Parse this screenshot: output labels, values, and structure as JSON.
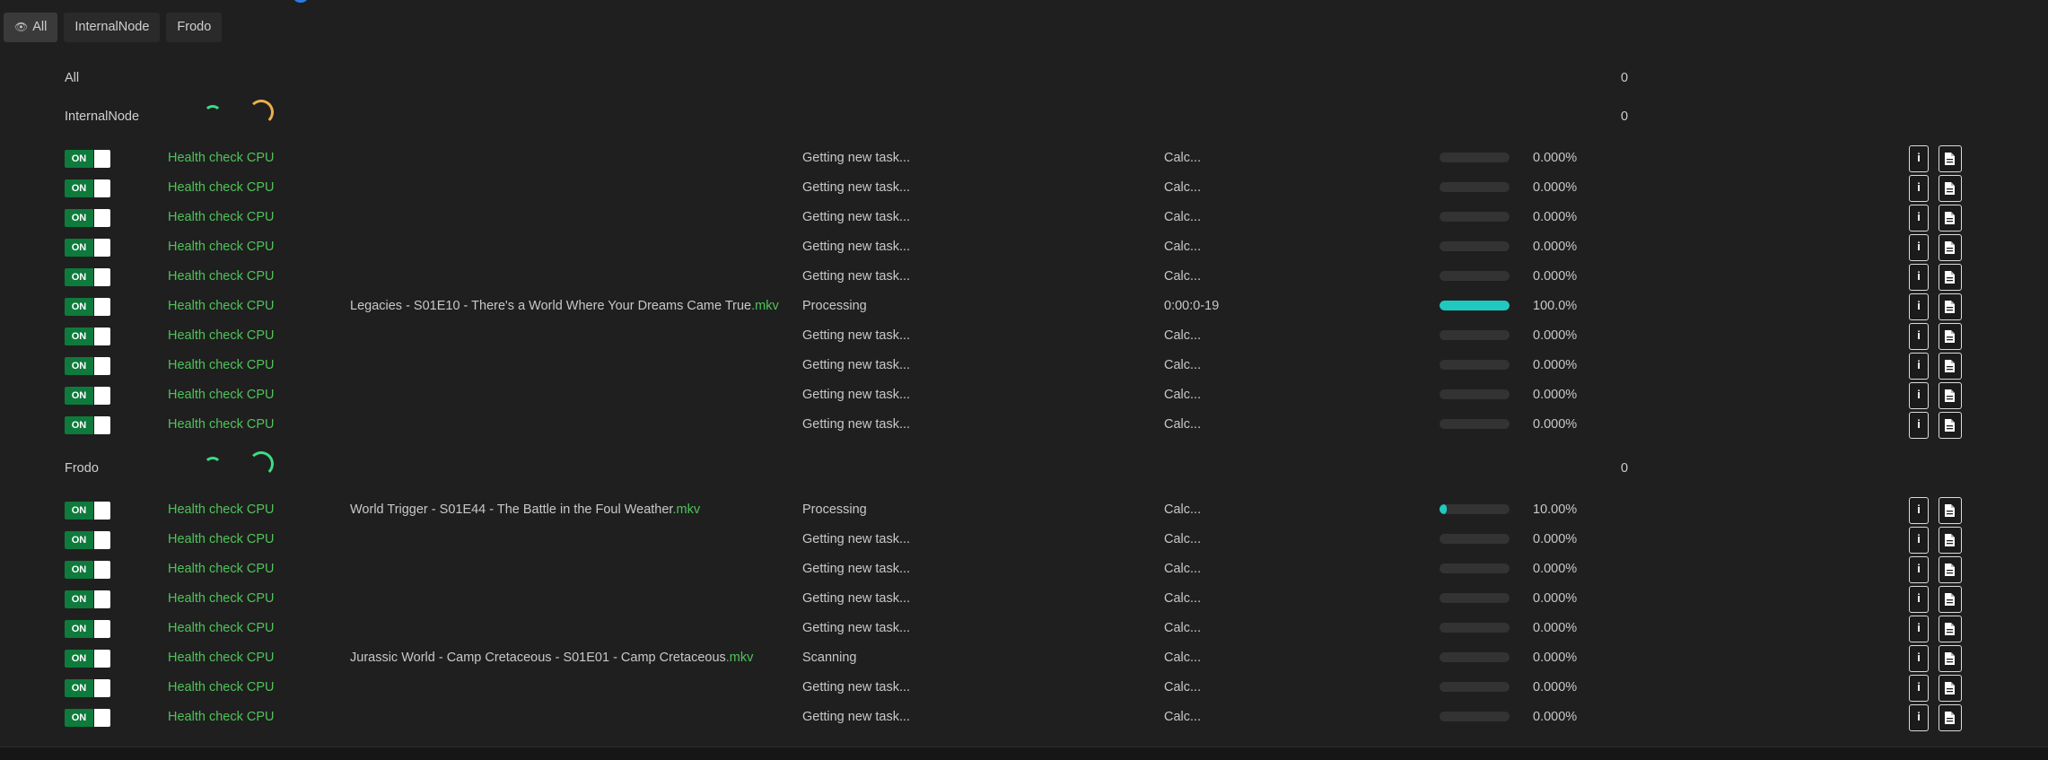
{
  "tabs": [
    {
      "label": "All",
      "active": true
    },
    {
      "label": "InternalNode",
      "active": false
    },
    {
      "label": "Frodo",
      "active": false
    }
  ],
  "groups": [
    {
      "name": "All",
      "count": "0",
      "workers": []
    },
    {
      "name": "InternalNode",
      "count": "0",
      "workers": [
        {
          "toggle": "ON",
          "plugin": "Health check CPU",
          "file": "",
          "ext": "",
          "status": "Getting new task...",
          "eta": "Calc...",
          "progress": 0,
          "pct": "0.000%"
        },
        {
          "toggle": "ON",
          "plugin": "Health check CPU",
          "file": "",
          "ext": "",
          "status": "Getting new task...",
          "eta": "Calc...",
          "progress": 0,
          "pct": "0.000%"
        },
        {
          "toggle": "ON",
          "plugin": "Health check CPU",
          "file": "",
          "ext": "",
          "status": "Getting new task...",
          "eta": "Calc...",
          "progress": 0,
          "pct": "0.000%"
        },
        {
          "toggle": "ON",
          "plugin": "Health check CPU",
          "file": "",
          "ext": "",
          "status": "Getting new task...",
          "eta": "Calc...",
          "progress": 0,
          "pct": "0.000%"
        },
        {
          "toggle": "ON",
          "plugin": "Health check CPU",
          "file": "",
          "ext": "",
          "status": "Getting new task...",
          "eta": "Calc...",
          "progress": 0,
          "pct": "0.000%"
        },
        {
          "toggle": "ON",
          "plugin": "Health check CPU",
          "file": "Legacies - S01E10 - There's a World Where Your Dreams Came True",
          "ext": ".mkv",
          "status": "Processing",
          "eta": "0:00:0-19",
          "progress": 100,
          "pct": "100.0%"
        },
        {
          "toggle": "ON",
          "plugin": "Health check CPU",
          "file": "",
          "ext": "",
          "status": "Getting new task...",
          "eta": "Calc...",
          "progress": 0,
          "pct": "0.000%"
        },
        {
          "toggle": "ON",
          "plugin": "Health check CPU",
          "file": "",
          "ext": "",
          "status": "Getting new task...",
          "eta": "Calc...",
          "progress": 0,
          "pct": "0.000%"
        },
        {
          "toggle": "ON",
          "plugin": "Health check CPU",
          "file": "",
          "ext": "",
          "status": "Getting new task...",
          "eta": "Calc...",
          "progress": 0,
          "pct": "0.000%"
        },
        {
          "toggle": "ON",
          "plugin": "Health check CPU",
          "file": "",
          "ext": "",
          "status": "Getting new task...",
          "eta": "Calc...",
          "progress": 0,
          "pct": "0.000%"
        }
      ]
    },
    {
      "name": "Frodo",
      "count": "0",
      "workers": [
        {
          "toggle": "ON",
          "plugin": "Health check CPU",
          "file": "World Trigger - S01E44 - The Battle in the Foul Weather",
          "ext": ".mkv",
          "status": "Processing",
          "eta": "Calc...",
          "progress": 10,
          "pct": "10.00%"
        },
        {
          "toggle": "ON",
          "plugin": "Health check CPU",
          "file": "",
          "ext": "",
          "status": "Getting new task...",
          "eta": "Calc...",
          "progress": 0,
          "pct": "0.000%"
        },
        {
          "toggle": "ON",
          "plugin": "Health check CPU",
          "file": "",
          "ext": "",
          "status": "Getting new task...",
          "eta": "Calc...",
          "progress": 0,
          "pct": "0.000%"
        },
        {
          "toggle": "ON",
          "plugin": "Health check CPU",
          "file": "",
          "ext": "",
          "status": "Getting new task...",
          "eta": "Calc...",
          "progress": 0,
          "pct": "0.000%"
        },
        {
          "toggle": "ON",
          "plugin": "Health check CPU",
          "file": "",
          "ext": "",
          "status": "Getting new task...",
          "eta": "Calc...",
          "progress": 0,
          "pct": "0.000%"
        },
        {
          "toggle": "ON",
          "plugin": "Health check CPU",
          "file": "Jurassic World - Camp Cretaceous - S01E01 - Camp Cretaceous",
          "ext": ".mkv",
          "status": "Scanning",
          "eta": "Calc...",
          "progress": 0,
          "pct": "0.000%"
        },
        {
          "toggle": "ON",
          "plugin": "Health check CPU",
          "file": "",
          "ext": "",
          "status": "Getting new task...",
          "eta": "Calc...",
          "progress": 0,
          "pct": "0.000%"
        },
        {
          "toggle": "ON",
          "plugin": "Health check CPU",
          "file": "",
          "ext": "",
          "status": "Getting new task...",
          "eta": "Calc...",
          "progress": 0,
          "pct": "0.000%"
        }
      ]
    }
  ],
  "info_button_label": "i",
  "icons": {
    "all_tab": "eye-icon",
    "log": "file-log-icon"
  },
  "colors": {
    "accent_green": "#4fc35a",
    "toggle_on": "#0e7a3c",
    "progress_fill": "#20c9c0",
    "background": "#1f1f1f"
  }
}
